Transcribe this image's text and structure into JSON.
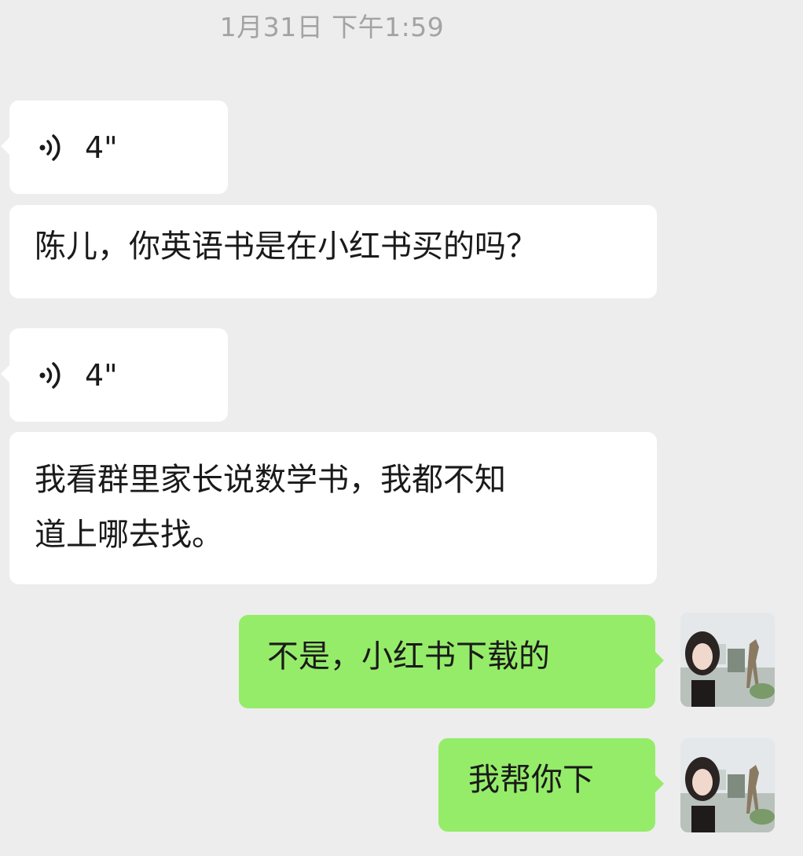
{
  "timestamp": "1月31日 下午1:59",
  "messages": [
    {
      "kind": "voice",
      "sender": "other",
      "duration": "4\""
    },
    {
      "kind": "text",
      "sender": "other",
      "text": "陈儿，你英语书是在小红书买的吗？"
    },
    {
      "kind": "voice",
      "sender": "other",
      "duration": "4\""
    },
    {
      "kind": "text",
      "sender": "other",
      "text_line1": "我看群里家长说数学书，我都不知",
      "text_line2": "道上哪去找。"
    },
    {
      "kind": "text",
      "sender": "me",
      "text": "不是，小红书下载的"
    },
    {
      "kind": "text",
      "sender": "me",
      "text": "我帮你下"
    }
  ],
  "colors": {
    "background": "#ededed",
    "incoming_bubble": "#ffffff",
    "outgoing_bubble": "#95ec69",
    "timestamp": "#a3a3a3"
  },
  "icons": {
    "voice": "voice-wave-icon",
    "avatar": "user-avatar-photo"
  }
}
